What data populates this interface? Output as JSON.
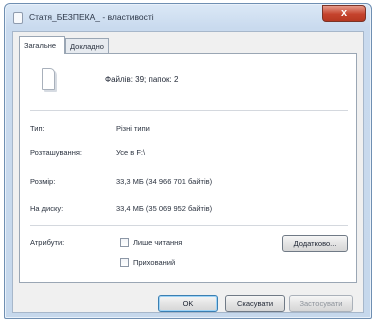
{
  "window": {
    "title": "Статя_БЕЗПЕКА_ - властивості",
    "close_label": "x"
  },
  "tabs": [
    {
      "label": "Загальне",
      "active": true
    },
    {
      "label": "Докладно",
      "active": false
    }
  ],
  "general": {
    "file_count": "Файлів: 39; папок: 2",
    "rows": [
      {
        "label": "Тип:",
        "value": "Різні типи"
      },
      {
        "label": "Розташування:",
        "value": "Усе в F:\\"
      },
      {
        "label": "Розмір:",
        "value": "33,3 МБ (34 966 701 байтів)"
      },
      {
        "label": "На диску:",
        "value": "33,4 МБ (35 069 952 байтів)"
      }
    ],
    "attributes_label": "Атрибути:",
    "attributes": [
      {
        "label": "Лише читання",
        "checked": false
      },
      {
        "label": "Прихований",
        "checked": false
      }
    ],
    "advanced_button": "Додатково..."
  },
  "buttons": {
    "ok": "OK",
    "cancel": "Скасувати",
    "apply": "Застосувати"
  }
}
